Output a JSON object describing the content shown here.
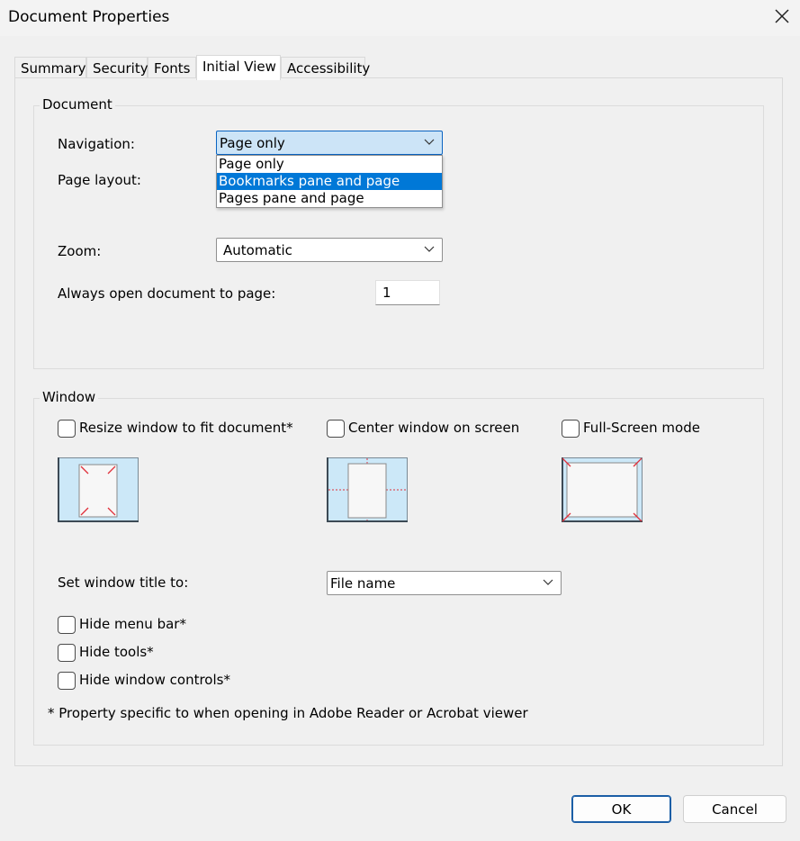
{
  "window": {
    "title": "Document Properties",
    "close_icon": "close-icon"
  },
  "tabs": [
    {
      "label": "Summary",
      "active": false
    },
    {
      "label": "Security",
      "active": false
    },
    {
      "label": "Fonts",
      "active": false
    },
    {
      "label": "Initial View",
      "active": true
    },
    {
      "label": "Accessibility",
      "active": false
    }
  ],
  "document_group": {
    "label": "Document",
    "navigation": {
      "label": "Navigation:",
      "value": "Page only",
      "options": [
        "Page only",
        "Bookmarks pane and page",
        "Pages pane and page"
      ],
      "highlighted_option": "Bookmarks pane and page"
    },
    "page_layout": {
      "label": "Page layout:"
    },
    "zoom": {
      "label": "Zoom:",
      "value": "Automatic"
    },
    "open_to_page": {
      "label": "Always open document to page:",
      "value": "1"
    }
  },
  "window_group": {
    "label": "Window",
    "resize": {
      "label": "Resize window to fit document*",
      "checked": false
    },
    "center": {
      "label": "Center window on screen",
      "checked": false
    },
    "fullscreen": {
      "label": "Full-Screen mode",
      "checked": false
    },
    "title_setting": {
      "label": "Set window title to:",
      "value": "File name"
    },
    "hide_menu_bar": {
      "label": "Hide menu bar*",
      "checked": false
    },
    "hide_tools": {
      "label": "Hide tools*",
      "checked": false
    },
    "hide_window_controls": {
      "label": "Hide window controls*",
      "checked": false
    },
    "footnote": "* Property specific to when opening in Adobe Reader or Acrobat viewer"
  },
  "buttons": {
    "ok": "OK",
    "cancel": "Cancel"
  },
  "colors": {
    "accent": "#0078d7",
    "combo_focus": "#cce4f7",
    "preview_bg": "#cce8f8",
    "guide_red": "#e0303a"
  }
}
